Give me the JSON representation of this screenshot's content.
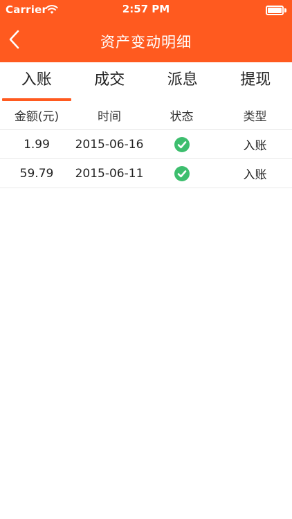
{
  "status_bar": {
    "carrier": "Carrier",
    "time": "2:57 PM"
  },
  "nav": {
    "title": "资产变动明细"
  },
  "tabs": [
    {
      "label": "入账",
      "active": true
    },
    {
      "label": "成交",
      "active": false
    },
    {
      "label": "派息",
      "active": false
    },
    {
      "label": "提现",
      "active": false
    }
  ],
  "table": {
    "headers": [
      "金额(元)",
      "时间",
      "状态",
      "类型"
    ],
    "rows": [
      {
        "amount": "1.99",
        "date": "2015-06-16",
        "status_icon": "check-circle-icon",
        "type": "入账"
      },
      {
        "amount": "59.79",
        "date": "2015-06-11",
        "status_icon": "check-circle-icon",
        "type": "入账"
      }
    ]
  },
  "colors": {
    "accent": "#FF5A1F",
    "success": "#3DBE6E"
  }
}
